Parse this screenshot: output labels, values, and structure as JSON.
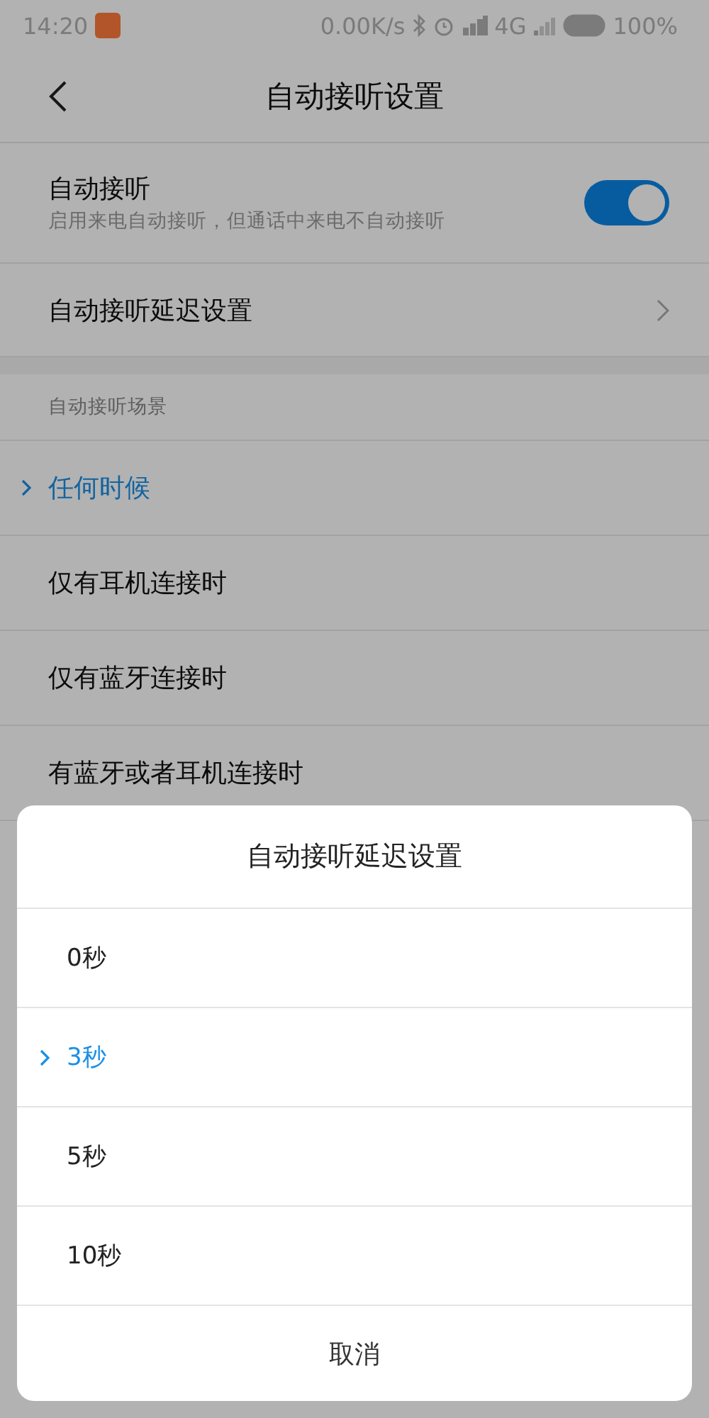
{
  "status_bar": {
    "time": "14:20",
    "speed": "0.00K/s",
    "network": "4G",
    "battery": "100%"
  },
  "header": {
    "title": "自动接听设置"
  },
  "settings": [
    {
      "kind": "toggle",
      "title": "自动接听",
      "subtitle": "启用来电自动接听，但通话中来电不自动接听",
      "on": true
    },
    {
      "kind": "link",
      "title": "自动接听延迟设置"
    }
  ],
  "scene_section": {
    "label": "自动接听场景",
    "items": [
      {
        "label": "任何时候",
        "selected": true
      },
      {
        "label": "仅有耳机连接时",
        "selected": false
      },
      {
        "label": "仅有蓝牙连接时",
        "selected": false
      },
      {
        "label": "有蓝牙或者耳机连接时",
        "selected": false
      }
    ]
  },
  "dialog": {
    "title": "自动接听延迟设置",
    "options": [
      {
        "label": "0秒",
        "selected": false
      },
      {
        "label": "3秒",
        "selected": true
      },
      {
        "label": "5秒",
        "selected": false
      },
      {
        "label": "10秒",
        "selected": false
      }
    ],
    "cancel": "取消"
  }
}
